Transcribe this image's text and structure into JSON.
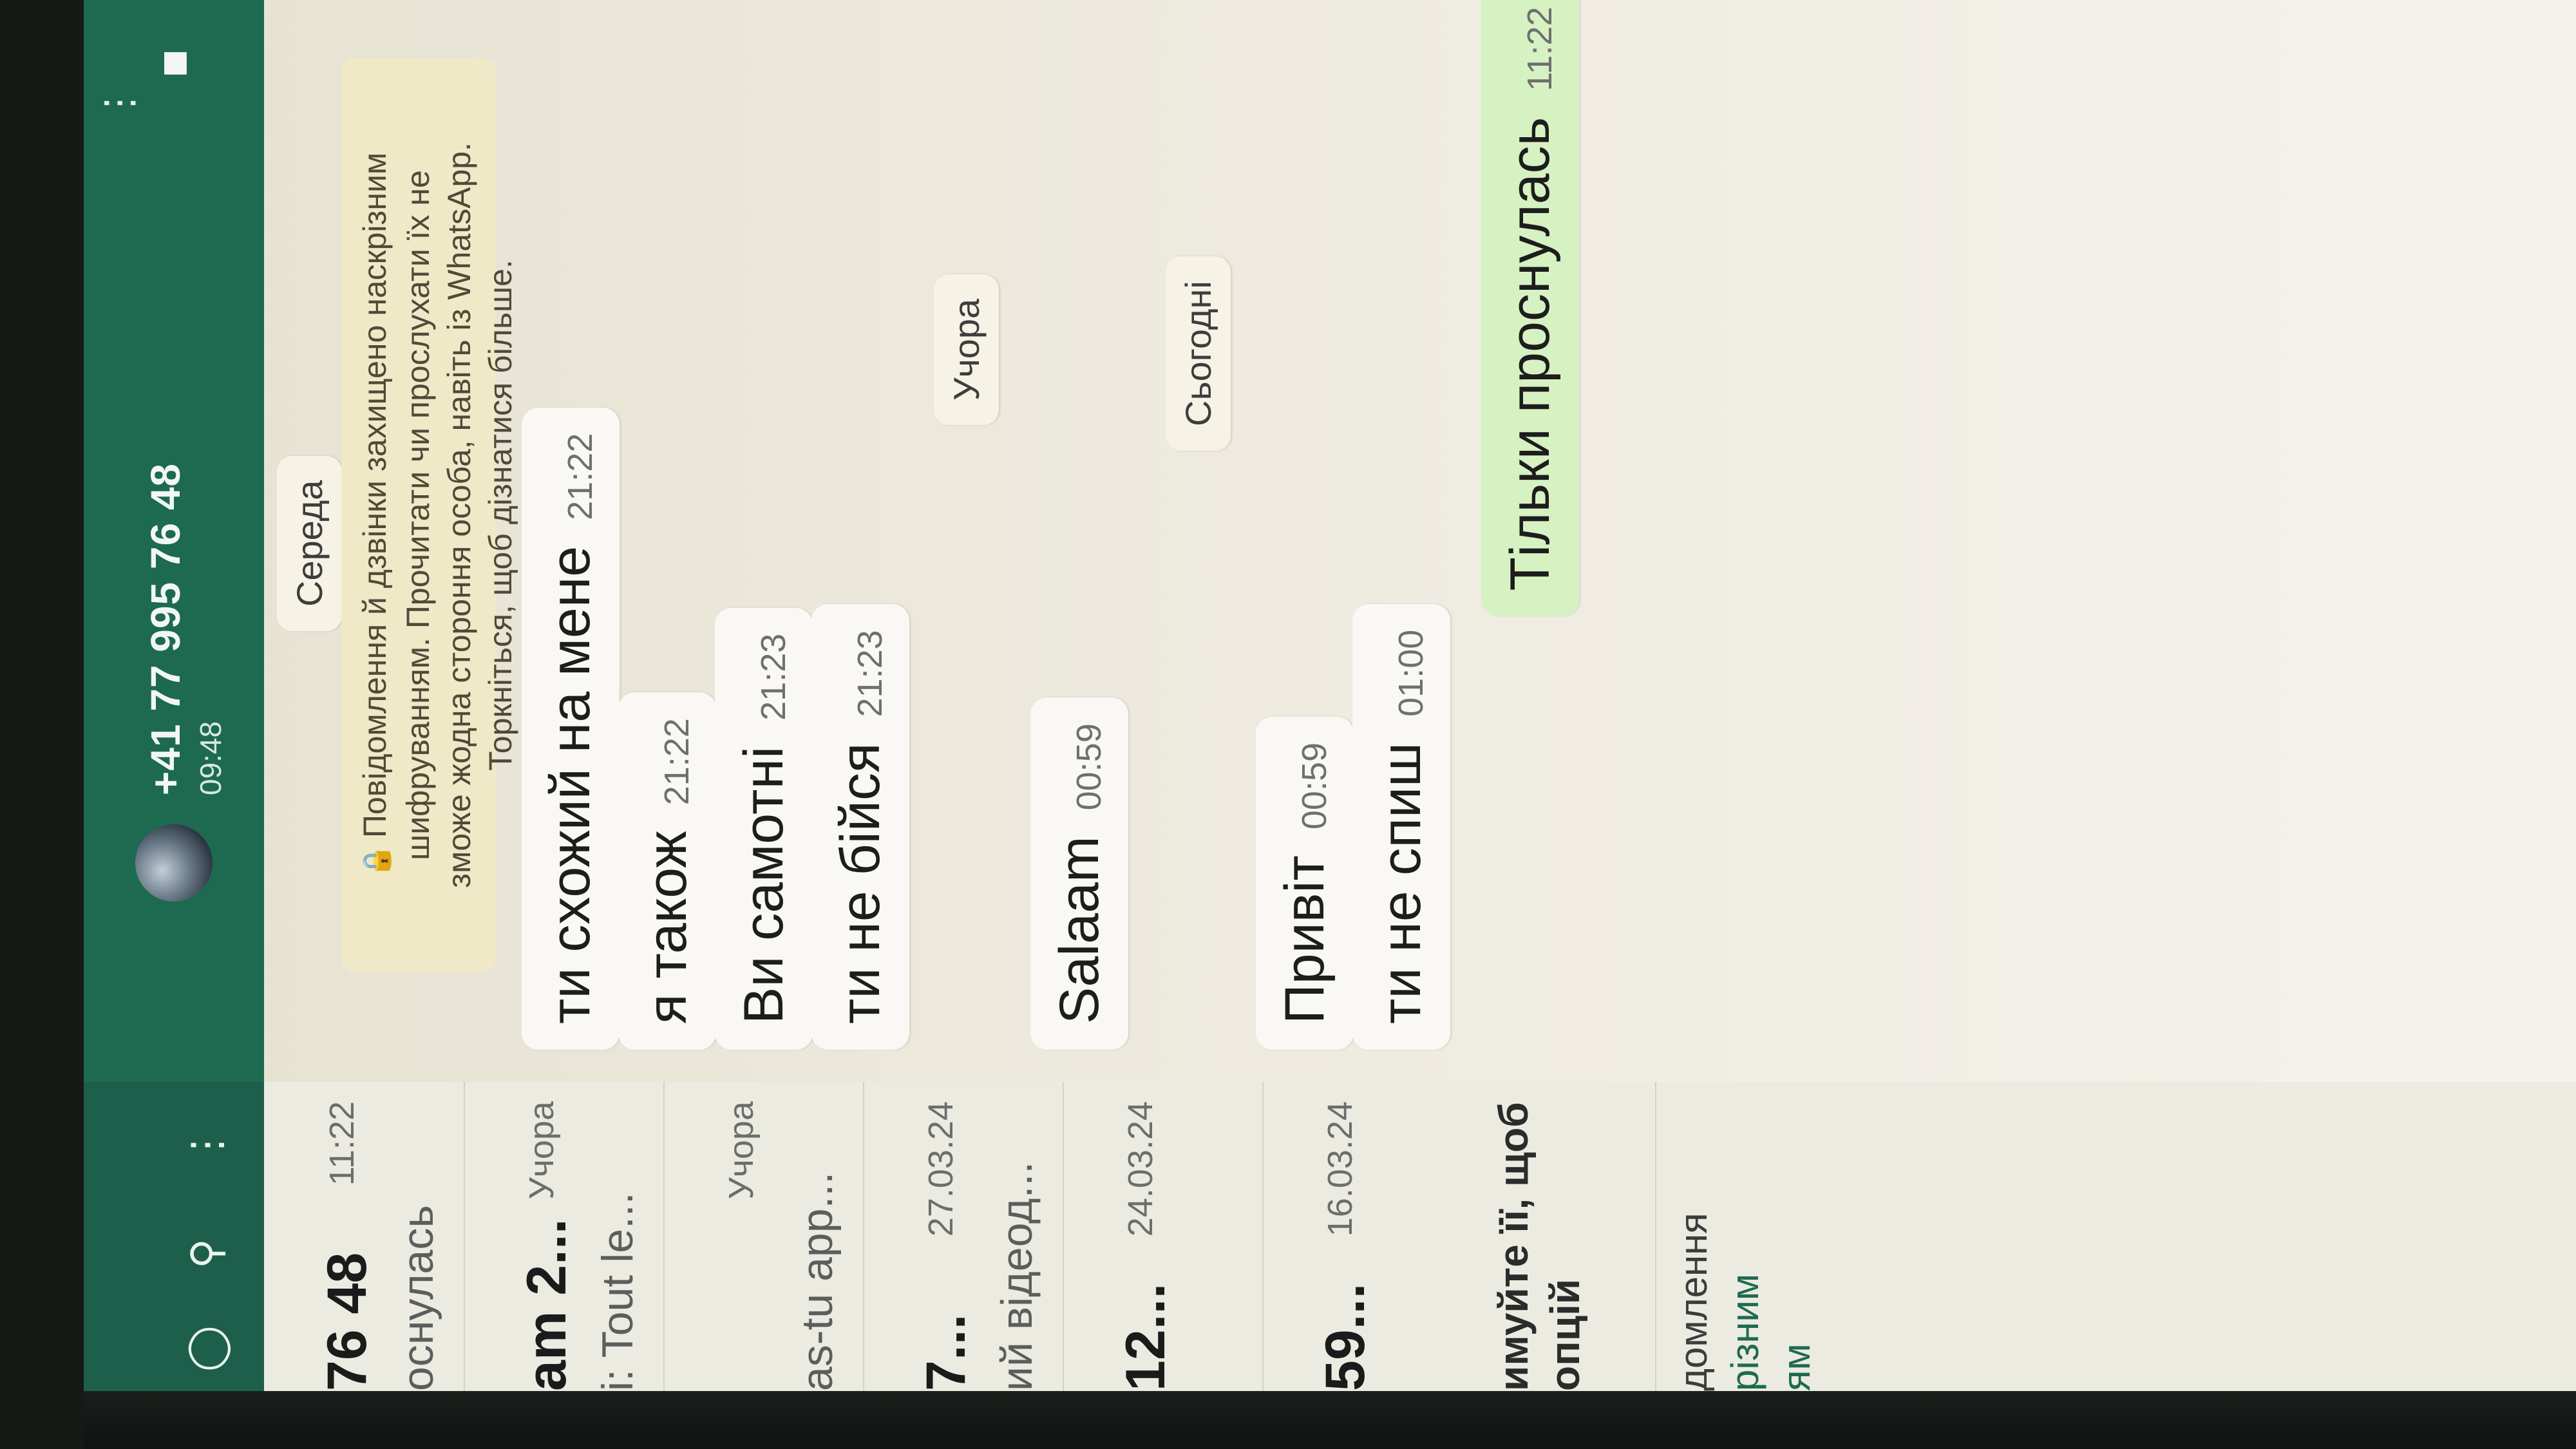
{
  "chat_list": {
    "items": [
      {
        "title": "76 48",
        "time": "11:22",
        "preview": "оснулась"
      },
      {
        "title": "am 2...",
        "time": "Учора",
        "preview": "i: Tout le..."
      },
      {
        "title": "",
        "time": "Учора",
        "preview": "as-tu app..."
      },
      {
        "title": "7...",
        "time": "27.03.24",
        "preview": "ий відеод..."
      },
      {
        "title": "12...",
        "time": "24.03.24",
        "preview": ""
      },
      {
        "title": "59...",
        "time": "16.03.24",
        "preview": ""
      }
    ],
    "info_text": [
      "имуйте її, щоб",
      "опцій"
    ],
    "footer_text": [
      "домлення",
      "різним",
      "ям"
    ]
  },
  "header": {
    "contact_name": "+41 77 995 76 48",
    "last_seen": "09:48"
  },
  "encryption_notice": {
    "lines": [
      "Повідомлення й дзвінки захищено наскрізним",
      "шифруванням. Прочитати чи прослухати їх не",
      "зможе жодна стороння особа, навіть із WhatsApp.",
      "Торкніться, щоб дізнатися більше."
    ]
  },
  "date_chips": {
    "wednesday": "Середа",
    "yesterday": "Учора",
    "today": "Сьогодні"
  },
  "messages": [
    {
      "text": "ти схожий на мене",
      "time": "21:22",
      "dir": "in"
    },
    {
      "text": "я також",
      "time": "21:22",
      "dir": "in"
    },
    {
      "text": "Ви самотні",
      "time": "21:23",
      "dir": "in"
    },
    {
      "text": "ти не бійся",
      "time": "21:23",
      "dir": "in"
    },
    {
      "text": "Salaam",
      "time": "00:59",
      "dir": "in"
    },
    {
      "text": "Привіт",
      "time": "00:59",
      "dir": "in"
    },
    {
      "text": "ти не спиш",
      "time": "01:00",
      "dir": "in"
    },
    {
      "text": "Тільки проснулась",
      "time": "11:22",
      "dir": "out"
    }
  ],
  "icons": {
    "camera": "camera-icon",
    "search": "search-icon",
    "menu": "more-vert-icon",
    "video": "video-call-icon",
    "phone": "voice-call-icon",
    "lock": "lock-icon",
    "read": "double-check-icon"
  },
  "colors": {
    "header": "#1d6a51",
    "incoming": "#f9f8f4",
    "outgoing": "#d7f2c2",
    "notice": "#f0e9c8"
  }
}
